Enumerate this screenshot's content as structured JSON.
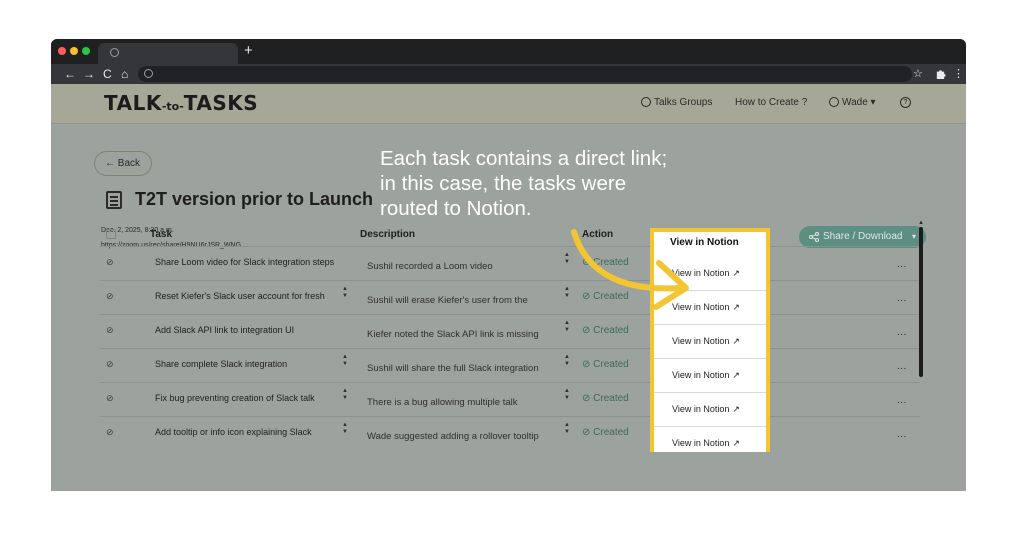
{
  "browser": {
    "new_tab_label": "+",
    "nav_back": "←",
    "nav_forward": "→",
    "nav_reload": "C",
    "nav_home": "⌂",
    "star_icon": "☆",
    "menu_icon": "⋮"
  },
  "header": {
    "logo_main_left": "TALK",
    "logo_mid": "-to-",
    "logo_main_right": "TASKS",
    "nav_talks_groups": "Talks Groups",
    "nav_how_to_create": "How to Create ?",
    "user_name": "Wade",
    "user_caret": "▾",
    "help_label": "?"
  },
  "page": {
    "back_label": "Back",
    "title": "T2T version prior to Launch",
    "date": "Dec. 2, 2025, 8:30 a.m.",
    "url": "https://zoom.us/rec/share/H9NU6rJSR_WNG...",
    "share_label": "Share / Download",
    "share_caret": "▾"
  },
  "table": {
    "columns": {
      "task": "Task",
      "description": "Description",
      "action": "Action",
      "view": "View in Notion"
    },
    "rows": [
      {
        "task": "Share Loom video for Slack integration steps",
        "description": "Sushil recorded a Loom video",
        "action": "Created",
        "view": "View in Notion",
        "more": "..."
      },
      {
        "task": "Reset Kiefer's Slack user account for fresh",
        "description": "Sushil will erase Kiefer's user from the",
        "action": "Created",
        "view": "View in Notion",
        "more": "..."
      },
      {
        "task": "Add Slack API link to integration UI",
        "description": "Kiefer noted the Slack API link is missing",
        "action": "Created",
        "view": "View in Notion",
        "more": "..."
      },
      {
        "task": "Share complete Slack integration",
        "description": "Sushil will share the full Slack integration",
        "action": "Created",
        "view": "View in Notion",
        "more": "..."
      },
      {
        "task": "Fix bug preventing creation of Slack talk",
        "description": "There is a bug allowing multiple talk",
        "action": "Created",
        "view": "View in Notion",
        "more": "..."
      },
      {
        "task": "Add tooltip or info icon explaining Slack",
        "description": "Wade suggested adding a rollover tooltip",
        "action": "Created",
        "view": "View in Notion",
        "more": "..."
      }
    ]
  },
  "annotation": {
    "line1": "Each task contains a direct link;",
    "line2": "in this case, the tasks were",
    "line3": "routed to Notion.",
    "highlight_color": "#f3c531"
  },
  "colors": {
    "overlay": "#9ca29e",
    "accent_green": "#5c8e82",
    "highlight": "#f3c531"
  }
}
